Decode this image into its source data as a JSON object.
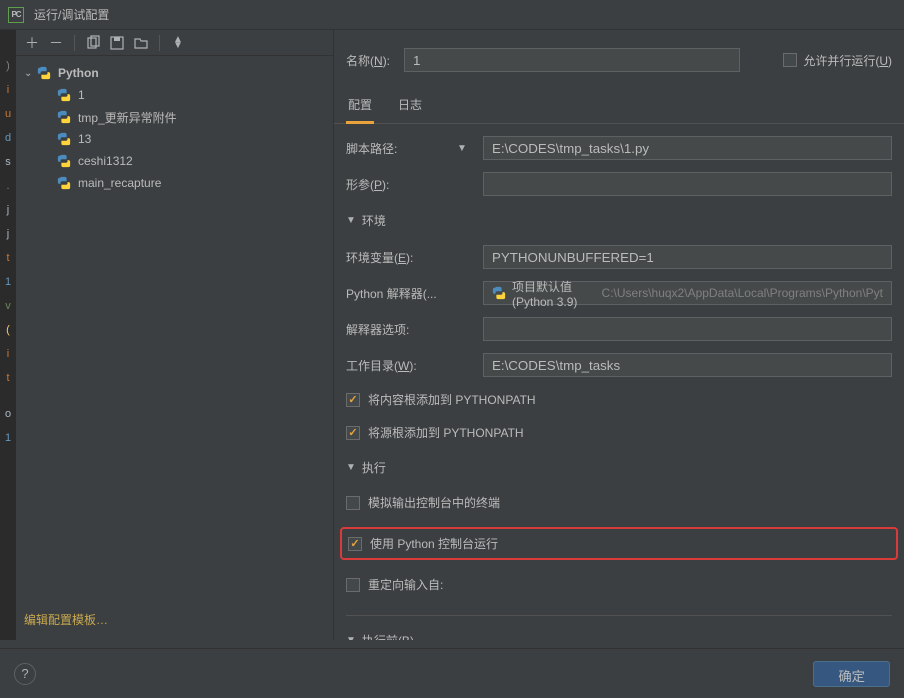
{
  "window": {
    "title": "运行/调试配置"
  },
  "sidebar": {
    "root": "Python",
    "items": [
      "1",
      "tmp_更新异常附件",
      "13",
      "ceshi1312",
      "main_recapture"
    ]
  },
  "edit_templates": "编辑配置模板…",
  "name_row": {
    "label": "名称",
    "hotkey": "N",
    "value": "1"
  },
  "parallel": {
    "label": "允许并行运行",
    "hotkey": "U",
    "checked": false
  },
  "tabs": {
    "config": "配置",
    "log": "日志"
  },
  "fields": {
    "script_path": {
      "label": "脚本路径:",
      "value": "E:\\CODES\\tmp_tasks\\1.py"
    },
    "params": {
      "label": "形参",
      "hotkey": "P",
      "value": ""
    },
    "env_section": "环境",
    "env_vars": {
      "label": "环境变量",
      "hotkey": "E",
      "value": "PYTHONUNBUFFERED=1"
    },
    "interpreter": {
      "label": "Python 解释器(...",
      "main": "项目默认值 (Python 3.9)",
      "path": "C:\\Users\\huqx2\\AppData\\Local\\Programs\\Python\\Pyt"
    },
    "interp_opts": {
      "label": "解释器选项:",
      "value": ""
    },
    "workdir": {
      "label": "工作目录",
      "hotkey": "W",
      "value": "E:\\CODES\\tmp_tasks"
    },
    "add_content_root": {
      "label": "将内容根添加到 PYTHONPATH",
      "checked": true
    },
    "add_source_root": {
      "label": "将源根添加到 PYTHONPATH",
      "checked": true
    },
    "exec_section": "执行",
    "emulate_term": {
      "label": "模拟输出控制台中的终端",
      "checked": false
    },
    "run_console": {
      "label": "使用 Python 控制台运行",
      "checked": true
    },
    "redirect_input": {
      "label": "重定向输入自:",
      "checked": false
    },
    "before_launch": {
      "label": "执行前",
      "hotkey": "B"
    }
  },
  "footer": {
    "ok": "确定"
  }
}
